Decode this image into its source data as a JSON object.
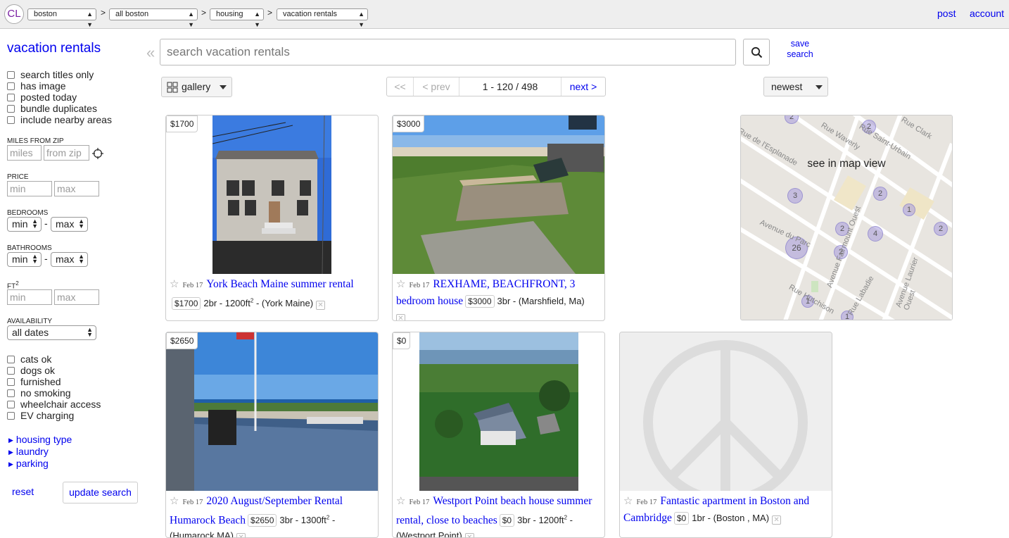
{
  "topbar": {
    "logo": "CL",
    "crumbs": [
      "boston",
      "all boston",
      "housing",
      "vacation rentals"
    ],
    "separator": ">",
    "post": "post",
    "account": "account"
  },
  "sidebar": {
    "title": "vacation rentals",
    "filters": [
      "search titles only",
      "has image",
      "posted today",
      "bundle duplicates",
      "include nearby areas"
    ],
    "miles_label": "MILES FROM ZIP",
    "miles_placeholder": "miles",
    "zip_placeholder": "from zip",
    "price_label": "PRICE",
    "min_placeholder": "min",
    "max_placeholder": "max",
    "bedrooms_label": "BEDROOMS",
    "bathrooms_label": "BATHROOMS",
    "min_select": "min",
    "max_select": "max",
    "dash": "-",
    "ft_label": "FT",
    "ft_sup": "2",
    "availability_label": "AVAILABILITY",
    "availability_value": "all dates",
    "amenities": [
      "cats ok",
      "dogs ok",
      "furnished",
      "no smoking",
      "wheelchair access",
      "EV charging"
    ],
    "expanders": [
      "housing type",
      "laundry",
      "parking"
    ],
    "reset": "reset",
    "update": "update search"
  },
  "search": {
    "placeholder": "search vacation rentals",
    "save_line1": "save",
    "save_line2": "search"
  },
  "controls": {
    "view": "gallery",
    "first": "<<",
    "prev": "< prev",
    "range": "1 - 120 / 498",
    "next": "next >",
    "sort": "newest"
  },
  "listings": [
    {
      "price": "$1700",
      "date": "Feb 17",
      "title": "York Beach Maine summer rental",
      "details_a": "2br - 1200ft",
      "sup": "2",
      "details_b": " - (York Maine)"
    },
    {
      "price": "$3000",
      "date": "Feb 17",
      "title": "REXHAME, BEACHFRONT, 3 bedroom house",
      "details_a": "3br - (Marshfield, Ma)",
      "sup": "",
      "details_b": ""
    },
    {
      "price": "$2650",
      "date": "Feb 17",
      "title": "2020 August/September Rental Humarock Beach",
      "details_a": "3br - 1300ft",
      "sup": "2",
      "details_b": " - (Humarock MA)"
    },
    {
      "price": "$0",
      "date": "Feb 17",
      "title": "Westport Point beach house summer rental, close to beaches",
      "details_a": "3br - 1200ft",
      "sup": "2",
      "details_b": " - (Westport Point)"
    },
    {
      "price": "$0",
      "date": "Feb 17",
      "title": "Fantastic apartment in Boston and Cambridge",
      "details_a": "1br - (Boston , MA)",
      "sup": "",
      "details_b": ""
    }
  ],
  "map": {
    "label": "see in map view",
    "clusters": [
      "2",
      "2",
      "3",
      "2",
      "1",
      "2",
      "4",
      "2",
      "26",
      "2",
      "1",
      "1",
      "2"
    ],
    "streets": [
      "Rue de l'Esplanade",
      "Rue Waverly",
      "Rue Saint-Urbain",
      "Rue Clark",
      "Avenue du Parc",
      "Avenue Fairmount Ouest",
      "Avenue Laurier Ouest",
      "Rue Hutchison",
      "Rue Labadie"
    ]
  }
}
